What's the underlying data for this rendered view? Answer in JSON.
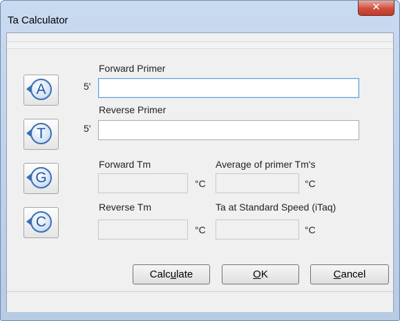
{
  "window": {
    "title": "Ta Calculator",
    "close_glyph": "✕"
  },
  "nucleotides": [
    {
      "letter": "A",
      "icon": "nucleotide-a-icon"
    },
    {
      "letter": "T",
      "icon": "nucleotide-t-icon"
    },
    {
      "letter": "G",
      "icon": "nucleotide-g-icon"
    },
    {
      "letter": "C",
      "icon": "nucleotide-c-icon"
    }
  ],
  "fields": {
    "forward_primer": {
      "label": "Forward Primer",
      "prefix": "5'",
      "value": ""
    },
    "reverse_primer": {
      "label": "Reverse Primer",
      "prefix": "5'",
      "value": ""
    },
    "forward_tm": {
      "label": "Forward Tm",
      "unit": "°C",
      "value": ""
    },
    "reverse_tm": {
      "label": "Reverse Tm",
      "unit": "°C",
      "value": ""
    },
    "average_tm": {
      "label": "Average of primer Tm's",
      "unit": "°C",
      "value": ""
    },
    "ta_standard": {
      "label": "Ta at Standard Speed (iTaq)",
      "unit": "°C",
      "value": ""
    }
  },
  "buttons": {
    "calculate": {
      "pre": "Calc",
      "mnemonic": "u",
      "post": "late"
    },
    "ok": {
      "pre": "",
      "mnemonic": "O",
      "post": "K"
    },
    "cancel": {
      "pre": "",
      "mnemonic": "C",
      "post": "ancel"
    }
  },
  "colors": {
    "frame": "#b7cbe5",
    "client": "#f0f0f0",
    "close": "#c23b2a",
    "accent": "#3a6fb5"
  }
}
